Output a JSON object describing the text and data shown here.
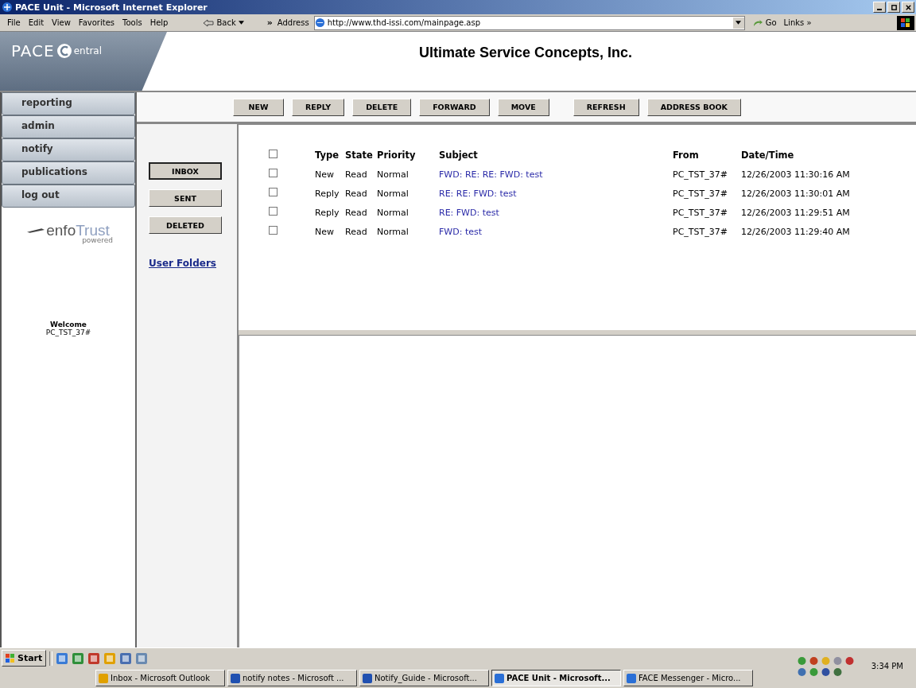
{
  "window": {
    "title": "PACE Unit - Microsoft Internet Explorer"
  },
  "menu": [
    "File",
    "Edit",
    "View",
    "Favorites",
    "Tools",
    "Help"
  ],
  "toolbar": {
    "back": "Back",
    "chevron": "»",
    "address_label": "Address",
    "address": "http://www.thd-issi.com/mainpage.asp",
    "go": "Go",
    "links": "Links »"
  },
  "header": {
    "logo_main": "PACE",
    "logo_sub": "entral",
    "company": "Ultimate Service Concepts, Inc."
  },
  "nav": [
    {
      "label": "reporting",
      "selected": false
    },
    {
      "label": "admin",
      "selected": false
    },
    {
      "label": "notify",
      "selected": false
    },
    {
      "label": "publications",
      "selected": false
    },
    {
      "label": "log out",
      "selected": false
    }
  ],
  "brand": {
    "name_a": "enfo",
    "name_b": "Trust",
    "sub": "powered"
  },
  "welcome": {
    "title": "Welcome",
    "user": "PC_TST_37#"
  },
  "actions": [
    "NEW",
    "REPLY",
    "DELETE",
    "FORWARD",
    "MOVE",
    "REFRESH",
    "ADDRESS BOOK"
  ],
  "folders": [
    {
      "label": "INBOX",
      "selected": true
    },
    {
      "label": "SENT",
      "selected": false
    },
    {
      "label": "DELETED",
      "selected": false
    }
  ],
  "user_folders": "User Folders",
  "table": {
    "header_checked": false,
    "columns": [
      "Type",
      "State",
      "Priority",
      "Subject",
      "From",
      "Date/Time"
    ],
    "rows": [
      {
        "checked": false,
        "type": "New",
        "state": "Read",
        "priority": "Normal",
        "subject": "FWD: RE: RE: FWD: test",
        "from": "PC_TST_37#",
        "date": "12/26/2003 11:30:16 AM"
      },
      {
        "checked": false,
        "type": "Reply",
        "state": "Read",
        "priority": "Normal",
        "subject": "RE: RE: FWD: test",
        "from": "PC_TST_37#",
        "date": "12/26/2003 11:30:01 AM"
      },
      {
        "checked": false,
        "type": "Reply",
        "state": "Read",
        "priority": "Normal",
        "subject": "RE: FWD: test",
        "from": "PC_TST_37#",
        "date": "12/26/2003 11:29:51 AM"
      },
      {
        "checked": false,
        "type": "New",
        "state": "Read",
        "priority": "Normal",
        "subject": "FWD: test",
        "from": "PC_TST_37#",
        "date": "12/26/2003 11:29:40 AM"
      }
    ]
  },
  "taskbar": {
    "start": "Start",
    "tasks": [
      {
        "label": "Inbox - Microsoft Outlook",
        "selected": false
      },
      {
        "label": "notify notes - Microsoft ...",
        "selected": false
      },
      {
        "label": "Notify_Guide - Microsoft...",
        "selected": false
      },
      {
        "label": "PACE Unit - Microsoft...",
        "selected": true
      },
      {
        "label": "FACE Messenger - Micro...",
        "selected": false
      }
    ],
    "clock": "3:34 PM"
  }
}
